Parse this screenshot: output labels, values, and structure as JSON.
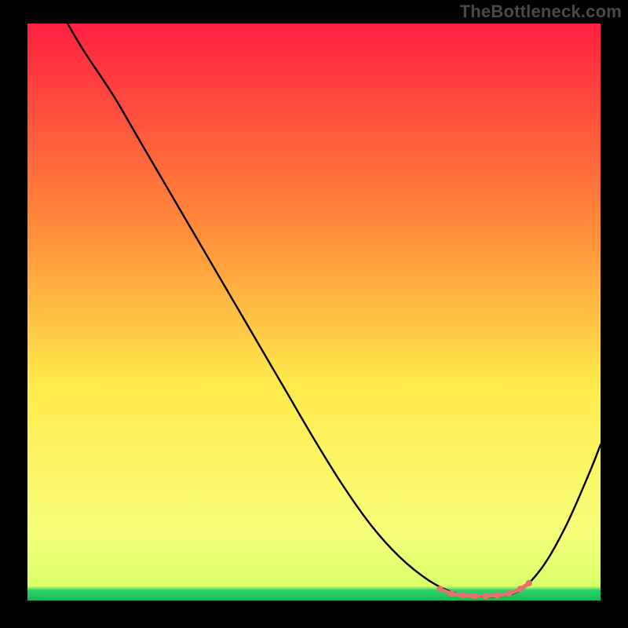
{
  "watermark": "TheBottleneck.com",
  "colors": {
    "frame_bg": "#000000",
    "curve": "#000000",
    "marker": "#e4716b",
    "gradient_top": "#ff203f",
    "gradient_mid1": "#ff8a3a",
    "gradient_mid2": "#ffe94a",
    "gradient_low": "#f8ff7a",
    "gradient_green": "#2bd36a"
  },
  "chart_data": {
    "type": "line",
    "title": "",
    "xlabel": "",
    "ylabel": "",
    "xlim": [
      0,
      100
    ],
    "ylim": [
      0,
      100
    ],
    "grid": false,
    "legend": false,
    "series": [
      {
        "name": "curve",
        "x": [
          7,
          10,
          15,
          20,
          25,
          30,
          35,
          40,
          45,
          50,
          55,
          60,
          65,
          70,
          74,
          78,
          82,
          86,
          90,
          94,
          98,
          100
        ],
        "y": [
          100,
          95,
          87.5,
          79,
          70.5,
          62,
          53.5,
          45,
          36.5,
          28,
          20,
          13,
          7.5,
          3.5,
          1.5,
          0.7,
          0.7,
          1.8,
          6,
          13,
          22,
          27
        ]
      }
    ],
    "markers": {
      "name": "highlight",
      "x": [
        72,
        74,
        76,
        78,
        80,
        82,
        84,
        86,
        87.5
      ],
      "y": [
        2.0,
        1.2,
        0.9,
        0.8,
        0.8,
        0.9,
        1.2,
        2.0,
        3.0
      ]
    }
  }
}
